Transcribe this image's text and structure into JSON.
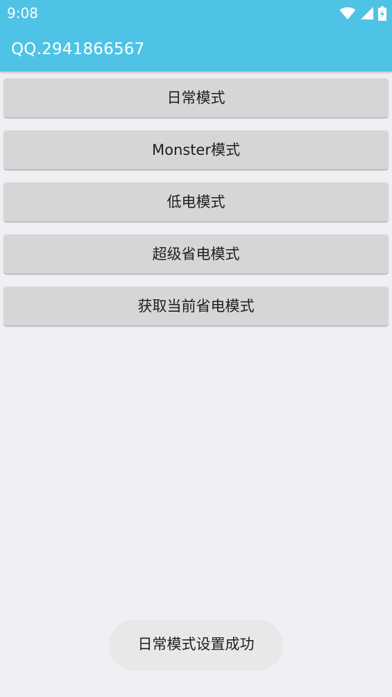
{
  "status_bar": {
    "time": "9:08",
    "icons": [
      "wifi-icon",
      "cell-signal-icon",
      "battery-charging-icon"
    ],
    "background": "#4fc3e6"
  },
  "app_bar": {
    "title": "QQ.2941866567",
    "background": "#4fc3e6"
  },
  "buttons": [
    {
      "label": "日常模式"
    },
    {
      "label": "Monster模式"
    },
    {
      "label": "低电模式"
    },
    {
      "label": "超级省电模式"
    },
    {
      "label": "获取当前省电模式"
    }
  ],
  "toast": {
    "message": "日常模式设置成功"
  },
  "colors": {
    "accent": "#4fc3e6",
    "page_background": "#efeff4",
    "button_background": "#d6d6d6"
  }
}
